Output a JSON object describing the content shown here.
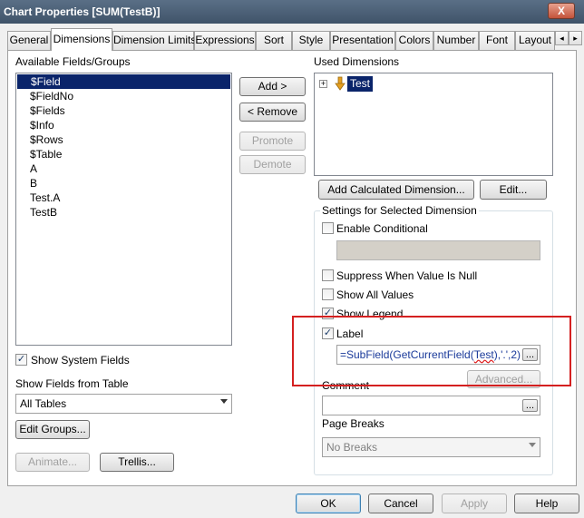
{
  "window": {
    "title": "Chart Properties [SUM(TestB)]",
    "close_label": "X"
  },
  "tabs": [
    {
      "label": "General"
    },
    {
      "label": "Dimensions"
    },
    {
      "label": "Dimension Limits"
    },
    {
      "label": "Expressions"
    },
    {
      "label": "Sort"
    },
    {
      "label": "Style"
    },
    {
      "label": "Presentation"
    },
    {
      "label": "Colors"
    },
    {
      "label": "Number"
    },
    {
      "label": "Font"
    },
    {
      "label": "Layout"
    }
  ],
  "tab_scroll": {
    "left": "◂",
    "right": "▸"
  },
  "available": {
    "label": "Available Fields/Groups",
    "items": [
      "$Field",
      "$FieldNo",
      "$Fields",
      "$Info",
      "$Rows",
      "$Table",
      "A",
      "B",
      "Test.A",
      "TestB"
    ],
    "selected_index": 0
  },
  "buttons": {
    "add": "Add >",
    "remove": "< Remove",
    "promote": "Promote",
    "demote": "Demote",
    "add_calculated": "Add Calculated Dimension...",
    "edit": "Edit...",
    "advanced": "Advanced...",
    "edit_groups": "Edit Groups...",
    "animate": "Animate...",
    "trellis": "Trellis...",
    "ok": "OK",
    "cancel": "Cancel",
    "apply": "Apply",
    "help": "Help",
    "ellipsis": "..."
  },
  "used": {
    "label": "Used Dimensions",
    "items": [
      {
        "label": "Test",
        "expand": "+"
      }
    ]
  },
  "show_system_fields": {
    "label": "Show System Fields",
    "checked": true
  },
  "fields_from_table": {
    "label": "Show Fields from Table",
    "value": "All Tables"
  },
  "settings": {
    "label": "Settings for Selected Dimension",
    "enable_conditional": {
      "label": "Enable Conditional",
      "checked": false
    },
    "suppress_null": {
      "label": "Suppress When Value Is Null",
      "checked": false
    },
    "show_all_values": {
      "label": "Show All Values",
      "checked": false
    },
    "show_legend": {
      "label": "Show Legend",
      "checked": true
    },
    "label_option": {
      "label": "Label",
      "checked": true
    },
    "label_expression": {
      "prefix": "=SubField(GetCurrentField(",
      "arg": "Test",
      "suffix": "),'.',2)"
    },
    "comment_label": "Comment",
    "page_breaks_label": "Page Breaks",
    "page_breaks_value": "No Breaks"
  },
  "colors": {
    "highlight": "#d42020",
    "selection": "#0a246a",
    "title_bar": "#4a5e75"
  }
}
